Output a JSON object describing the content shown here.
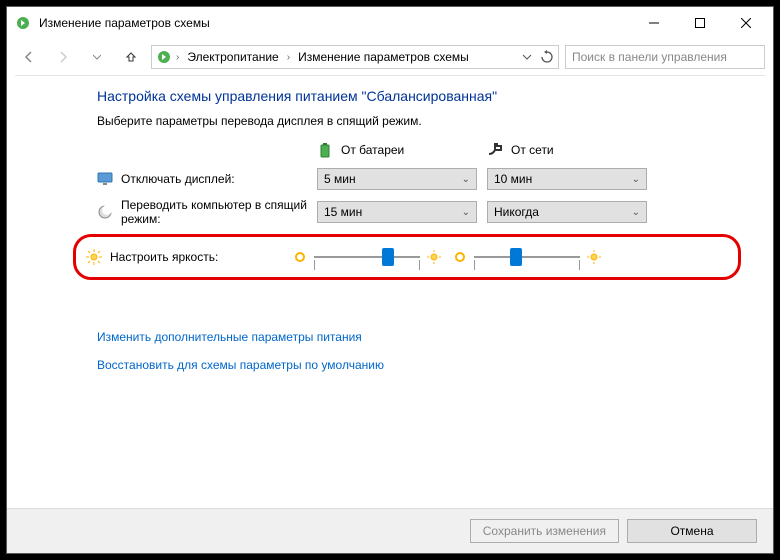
{
  "titlebar": {
    "title": "Изменение параметров схемы"
  },
  "breadcrumb": {
    "seg1": "Электропитание",
    "seg2": "Изменение параметров схемы"
  },
  "search": {
    "placeholder": "Поиск в панели управления"
  },
  "heading": "Настройка схемы управления питанием \"Сбалансированная\"",
  "subtitle": "Выберите параметры перевода дисплея в спящий режим.",
  "cols": {
    "battery": "От батареи",
    "ac": "От сети"
  },
  "rows": {
    "display_off": {
      "label": "Отключать дисплей:",
      "battery": "5 мин",
      "ac": "10 мин"
    },
    "sleep": {
      "label": "Переводить компьютер в спящий режим:",
      "battery": "15 мин",
      "ac": "Никогда"
    },
    "brightness": {
      "label": "Настроить яркость:",
      "battery_pct": 70,
      "ac_pct": 40
    }
  },
  "links": {
    "advanced": "Изменить дополнительные параметры питания",
    "restore": "Восстановить для схемы параметры по умолчанию"
  },
  "buttons": {
    "save": "Сохранить изменения",
    "cancel": "Отмена"
  }
}
